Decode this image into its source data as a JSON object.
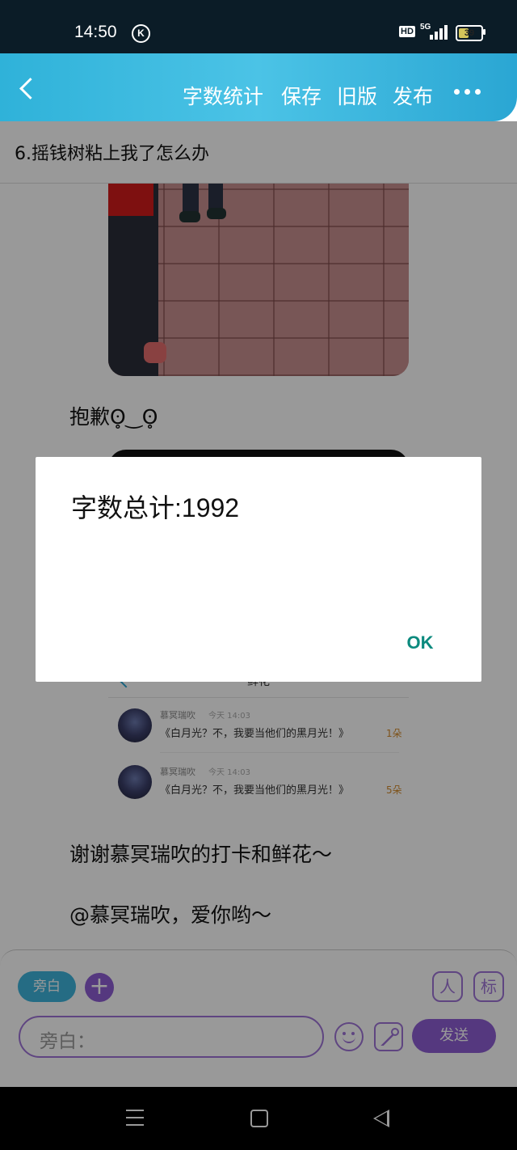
{
  "status_bar": {
    "time": "14:50",
    "hd": "HD",
    "network": "5G",
    "battery": "39"
  },
  "header": {
    "buttons": [
      "字数统计",
      "保存",
      "旧版",
      "发布"
    ]
  },
  "content": {
    "chapter_title": "6.摇钱树粘上我了怎么办",
    "apology": "抱歉ʘ̥‿ʘ̥",
    "gift_card": {
      "title": "鲜花",
      "rows": [
        {
          "name": "慕冥瑞吹",
          "time": "今天 14:03",
          "message": "《白月光？不，我要当他们的黑月光！》",
          "count": "1朵"
        },
        {
          "name": "慕冥瑞吹",
          "time": "今天 14:03",
          "message": "《白月光？不，我要当他们的黑月光！》",
          "count": "5朵"
        }
      ]
    },
    "thanks": "谢谢慕冥瑞吹的打卡和鲜花～",
    "mention": "@慕冥瑞吹，爱你哟～"
  },
  "input_area": {
    "aside_tag": "旁白",
    "plus": "+",
    "role_button": "人",
    "mark_button": "标",
    "placeholder": "旁白：",
    "send": "发送"
  },
  "dialog": {
    "message": "字数总计:1992",
    "ok": "OK"
  },
  "icons": {
    "back": "back-icon",
    "more": "more-icon",
    "emoji": "emoji-icon",
    "image": "image-icon"
  },
  "colors": {
    "header": "#2fb2d9",
    "accent_purple": "#8e5ed4",
    "ok_teal": "#0c8a7e"
  }
}
